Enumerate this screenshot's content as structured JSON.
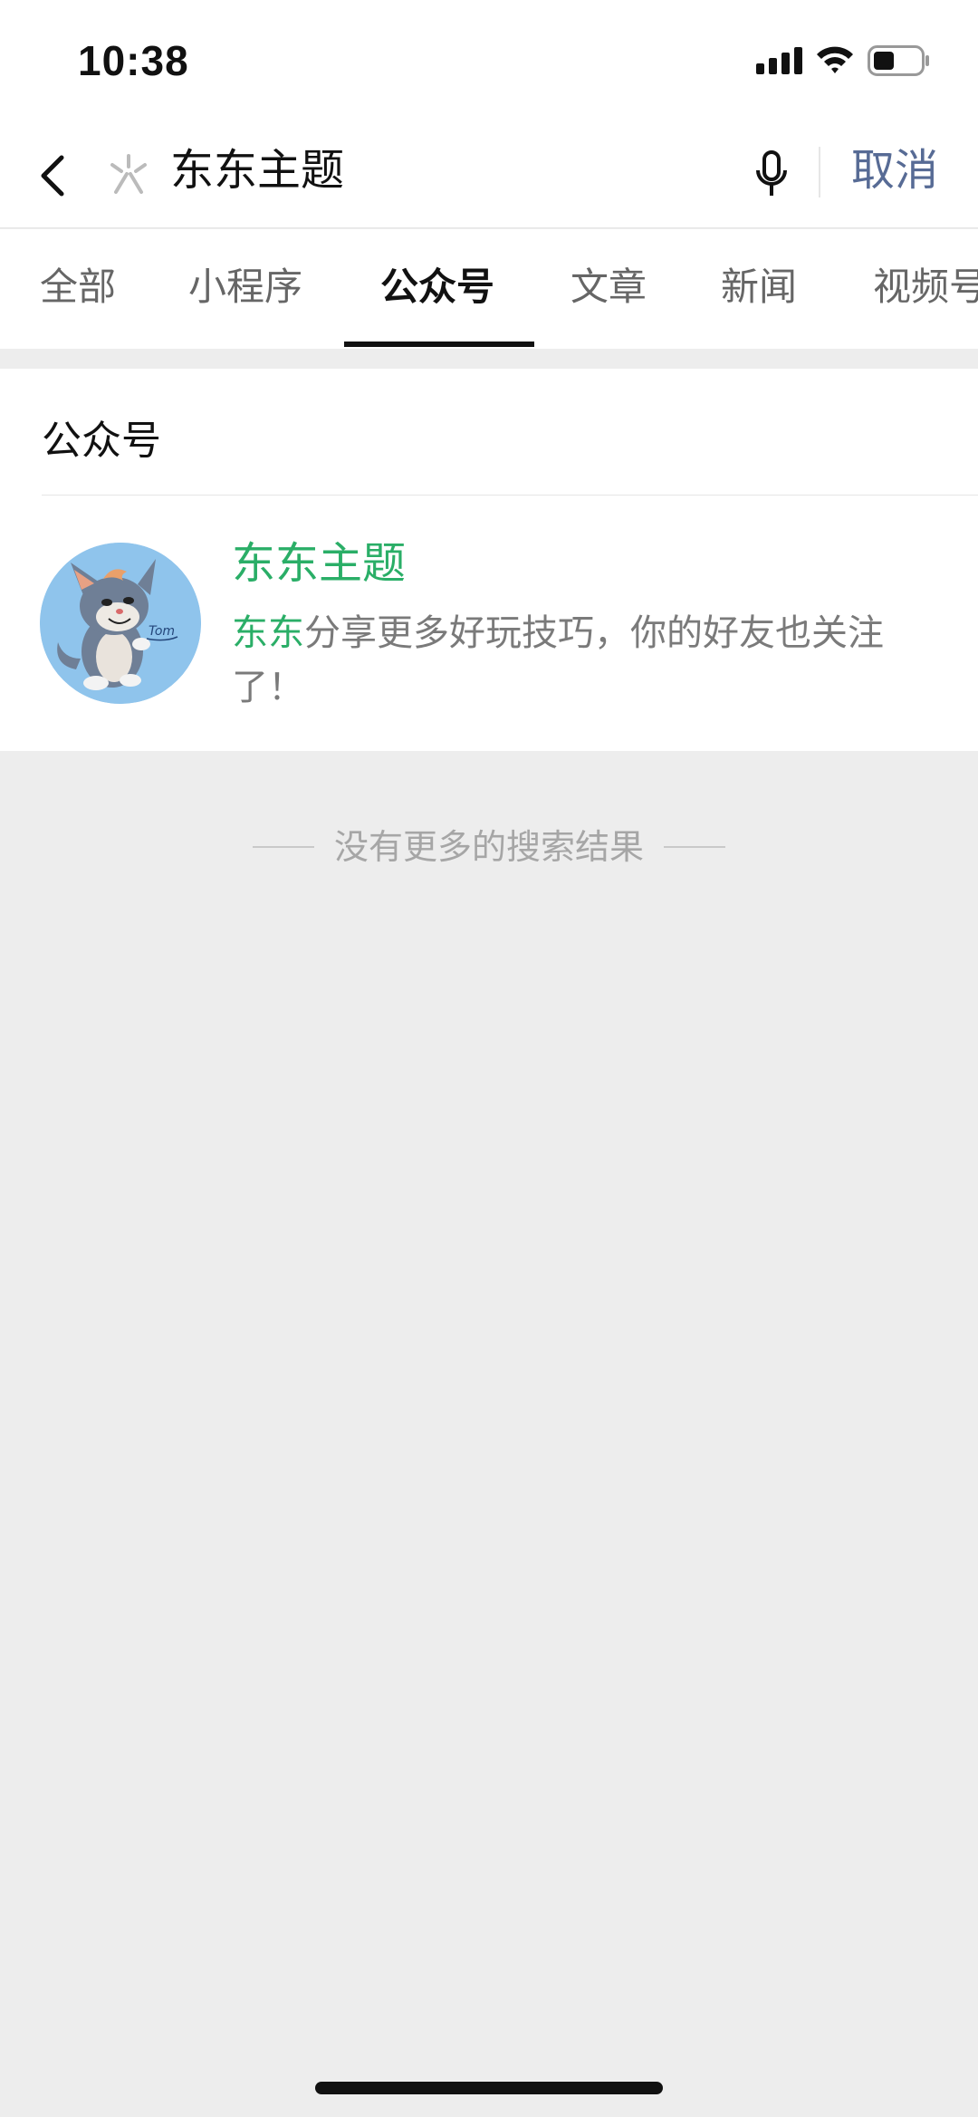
{
  "status_bar": {
    "time": "10:38",
    "icons": [
      "signal-icon",
      "wifi-icon",
      "battery-icon"
    ]
  },
  "search": {
    "query": "东东主题",
    "cancel_label": "取消",
    "icons": [
      "back-icon",
      "search-glyph-icon",
      "mic-icon"
    ]
  },
  "tabs": [
    {
      "label": "全部",
      "active": false
    },
    {
      "label": "小程序",
      "active": false
    },
    {
      "label": "公众号",
      "active": true
    },
    {
      "label": "文章",
      "active": false
    },
    {
      "label": "新闻",
      "active": false
    },
    {
      "label": "视频号",
      "active": false
    }
  ],
  "results": {
    "section_title": "公众号",
    "items": [
      {
        "name": "东东主题",
        "desc_highlight": "东东",
        "desc_rest": "分享更多好玩技巧，你的好友也关注了！",
        "avatar_label": "Tom"
      }
    ]
  },
  "footer_note": "没有更多的搜索结果",
  "colors": {
    "accent_green": "#2aae67",
    "link_blue": "#576b95",
    "background": "#ededed"
  }
}
